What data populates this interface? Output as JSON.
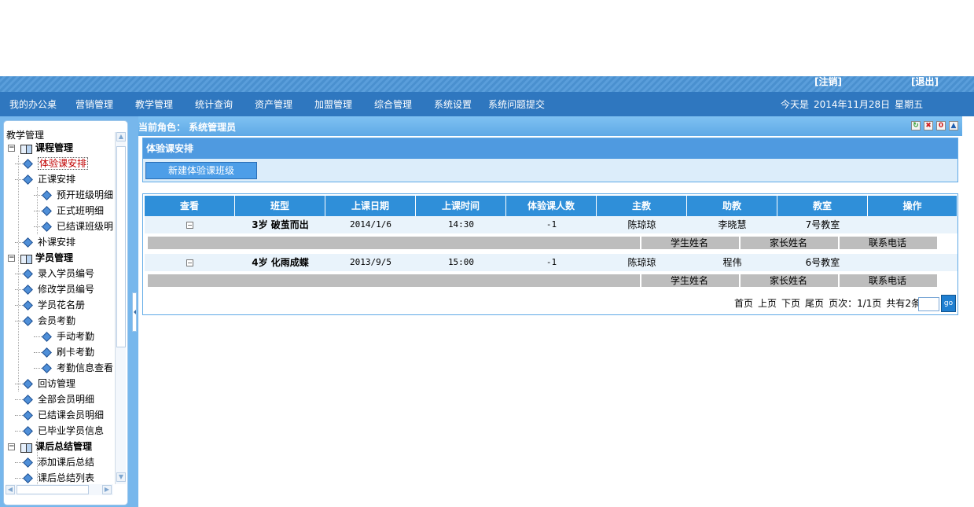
{
  "topbar": {
    "logout": "[注销]",
    "exit": "[退出]"
  },
  "nav": {
    "items": [
      "我的办公桌",
      "营销管理",
      "教学管理",
      "统计查询",
      "资产管理",
      "加盟管理",
      "综合管理",
      "系统设置",
      "系统问题提交"
    ],
    "today_label": "今天是",
    "date": "2014年11月28日",
    "weekday": "星期五"
  },
  "sidebar": {
    "root": "教学管理",
    "items": [
      {
        "label": "课程管理",
        "type": "group"
      },
      {
        "label": "体验课安排",
        "type": "leaf",
        "active": true
      },
      {
        "label": "正课安排",
        "type": "leaf"
      },
      {
        "label": "预开班级明细",
        "type": "subleaf"
      },
      {
        "label": "正式班明细",
        "type": "subleaf"
      },
      {
        "label": "已结课班级明",
        "type": "subleaf"
      },
      {
        "label": "补课安排",
        "type": "leaf"
      },
      {
        "label": "学员管理",
        "type": "group"
      },
      {
        "label": "录入学员编号",
        "type": "leaf"
      },
      {
        "label": "修改学员编号",
        "type": "leaf"
      },
      {
        "label": "学员花名册",
        "type": "leaf"
      },
      {
        "label": "会员考勤",
        "type": "leaf"
      },
      {
        "label": "手动考勤",
        "type": "subleaf"
      },
      {
        "label": "刷卡考勤",
        "type": "subleaf"
      },
      {
        "label": "考勤信息查看",
        "type": "subleaf"
      },
      {
        "label": "回访管理",
        "type": "leaf"
      },
      {
        "label": "全部会员明细",
        "type": "leaf"
      },
      {
        "label": "已结课会员明细",
        "type": "leaf"
      },
      {
        "label": "已毕业学员信息",
        "type": "leaf"
      },
      {
        "label": "课后总结管理",
        "type": "group"
      },
      {
        "label": "添加课后总结",
        "type": "leaf"
      },
      {
        "label": "课后总结列表",
        "type": "leaf"
      }
    ]
  },
  "role": {
    "text": "当前角色： 系统管理员"
  },
  "toolbar_icons": [
    {
      "icon": "refresh-icon",
      "glyph": "↻",
      "color": "#2a9b2a"
    },
    {
      "icon": "delete-icon",
      "glyph": "✖",
      "color": "#d02020"
    },
    {
      "icon": "zero-icon",
      "glyph": "0",
      "color": "#d02020"
    },
    {
      "icon": "up-icon",
      "glyph": "▲",
      "color": "#1f5fb0"
    }
  ],
  "section": {
    "title": "体验课安排",
    "new_button": "新建体验课班级"
  },
  "table": {
    "headers": [
      "查看",
      "班型",
      "上课日期",
      "上课时间",
      "体验课人数",
      "主教",
      "助教",
      "教室",
      "操作"
    ],
    "toggle": "−",
    "rows": [
      {
        "class_type": "3岁 破茧而出",
        "date": "2014/1/6",
        "time": "14:30",
        "count": "-1",
        "teacher": "陈琼琼",
        "assistant": "李晓慧",
        "room": "7号教室",
        "action": ""
      },
      {
        "class_type": "4岁 化雨成蝶",
        "date": "2013/9/5",
        "time": "15:00",
        "count": "-1",
        "teacher": "陈琼琼",
        "assistant": "程伟",
        "room": "6号教室",
        "action": ""
      }
    ],
    "sub_headers": [
      "学生姓名",
      "家长姓名",
      "联系电话"
    ]
  },
  "pager": {
    "first": "首页",
    "prev": "上页",
    "next": "下页",
    "last": "尾页",
    "pages": "页次：1/1页",
    "total": "共有2条",
    "go": "go"
  }
}
